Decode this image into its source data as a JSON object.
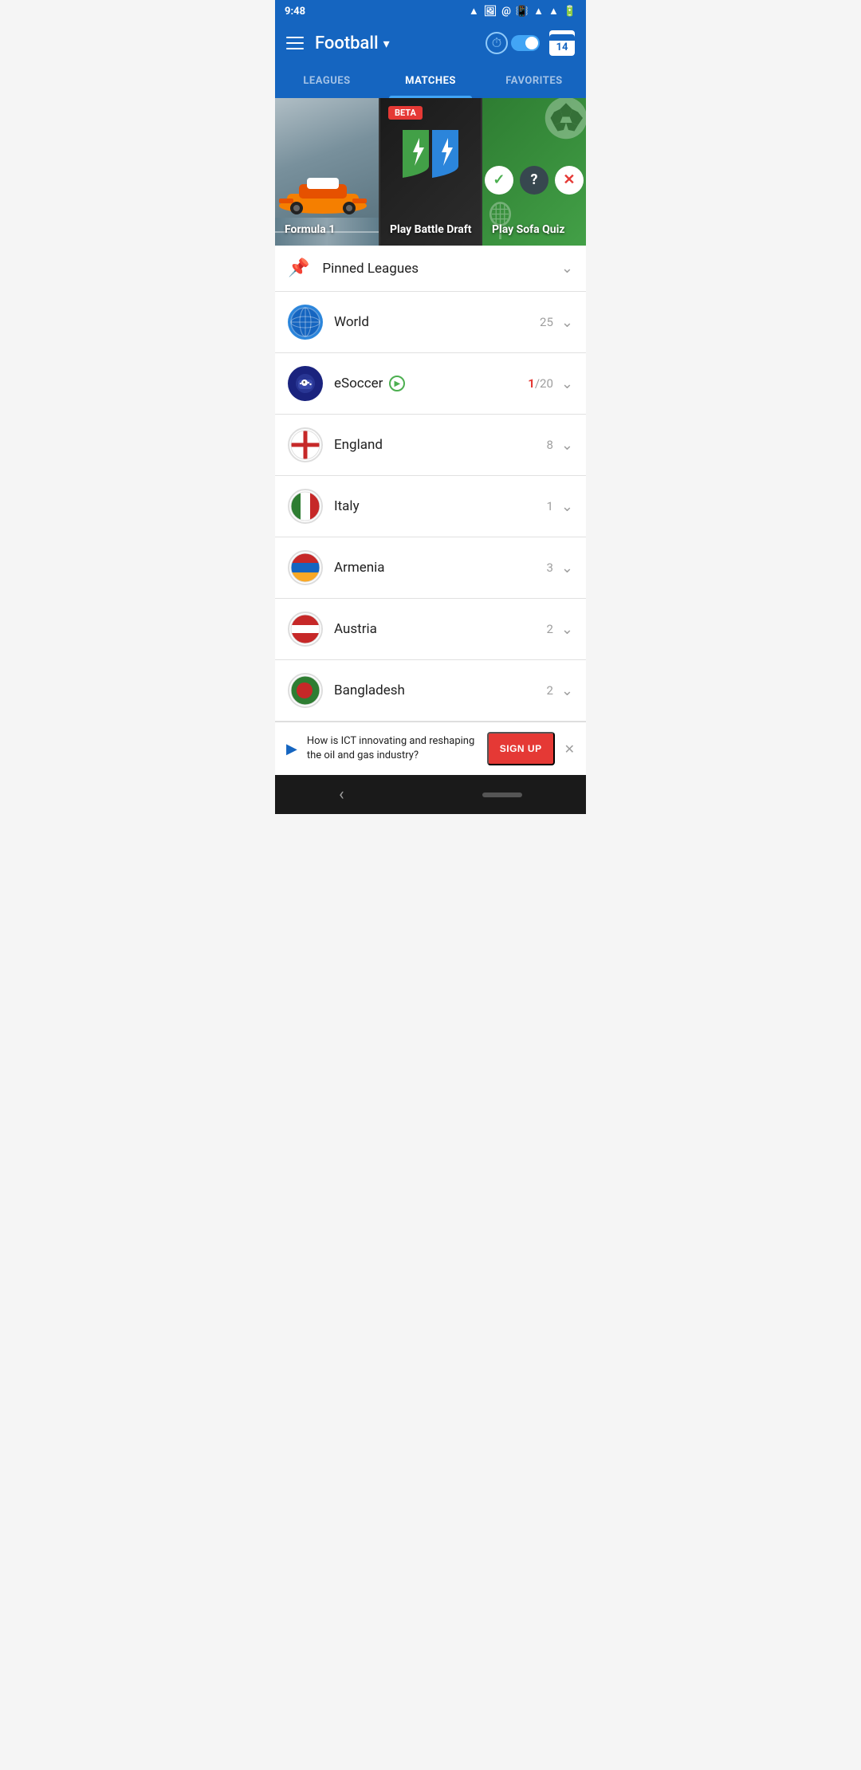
{
  "statusBar": {
    "time": "9:48",
    "icons": [
      "drive",
      "image",
      "at"
    ]
  },
  "header": {
    "title": "Football",
    "dropdownArrow": "▼"
  },
  "tabs": [
    {
      "id": "leagues",
      "label": "LEAGUES",
      "active": false
    },
    {
      "id": "matches",
      "label": "MATCHES",
      "active": true
    },
    {
      "id": "favorites",
      "label": "FAVORITES",
      "active": false
    }
  ],
  "cards": [
    {
      "id": "formula1",
      "label": "Formula 1",
      "badge": null
    },
    {
      "id": "battle-draft",
      "label": "Play Battle Draft",
      "badge": "BETA"
    },
    {
      "id": "sofa-quiz",
      "label": "Play Sofa Quiz",
      "badge": null
    }
  ],
  "pinnedLeagues": {
    "label": "Pinned Leagues"
  },
  "leagueList": [
    {
      "id": "world",
      "name": "World",
      "count": "25",
      "live": false,
      "liveCount": null
    },
    {
      "id": "esoccer",
      "name": "eSoccer",
      "count": "20",
      "live": true,
      "liveCount": "1"
    },
    {
      "id": "england",
      "name": "England",
      "count": "8",
      "live": false,
      "liveCount": null
    },
    {
      "id": "italy",
      "name": "Italy",
      "count": "1",
      "live": false,
      "liveCount": null
    },
    {
      "id": "armenia",
      "name": "Armenia",
      "count": "3",
      "live": false,
      "liveCount": null
    },
    {
      "id": "austria",
      "name": "Austria",
      "count": "2",
      "live": false,
      "liveCount": null
    },
    {
      "id": "bangladesh",
      "name": "Bangladesh",
      "count": "2",
      "live": false,
      "liveCount": null
    }
  ],
  "ad": {
    "text": "How is ICT innovating and reshaping the oil and gas industry?",
    "signupLabel": "SIGN UP"
  },
  "colors": {
    "primary": "#1565C0",
    "accent": "#42A5F5",
    "live": "#e53935",
    "green": "#4CAF50"
  }
}
